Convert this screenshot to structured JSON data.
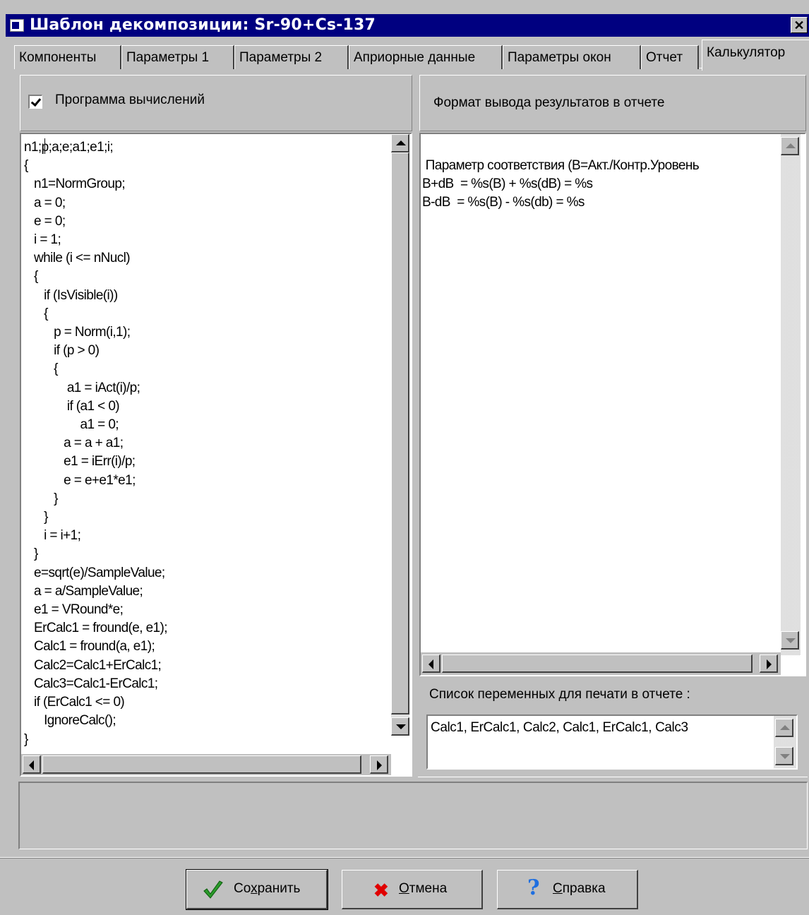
{
  "window": {
    "title": "Шаблон декомпозиции: Sr-90+Cs-137",
    "close_label": "✕"
  },
  "tabs": [
    {
      "label": "Компоненты"
    },
    {
      "label": "Параметры 1"
    },
    {
      "label": "Параметры 2"
    },
    {
      "label": "Априорные данные"
    },
    {
      "label": "Параметры окон"
    },
    {
      "label": "Отчет"
    },
    {
      "label": "Калькулятор",
      "active": true
    }
  ],
  "left_panel": {
    "checkbox_label": "Программа вычислений",
    "checked": true,
    "code": "n1;p;a;e;a1;e1;i;\n{\n   n1=NormGroup;\n   a = 0;\n   e = 0;\n   i = 1;\n   while (i <= nNucl)\n   {\n      if (IsVisible(i))\n      {\n         p = Norm(i,1);\n         if (p > 0)\n         {\n             a1 = iAct(i)/p;\n             if (a1 < 0)\n                 a1 = 0;\n            a = a + a1;\n            e1 = iErr(i)/p;\n            e = e+e1*e1;\n         }\n      }\n      i = i+1;\n   }\n   e=sqrt(e)/SampleValue;\n   a = a/SampleValue;\n   e1 = VRound*e;\n   ErCalc1 = fround(e, e1);\n   Calc1 = fround(a, e1);\n   Calc2=Calc1+ErCalc1;\n   Calc3=Calc1-ErCalc1;\n   if (ErCalc1 <= 0)\n      IgnoreCalc();\n}"
  },
  "right_panel": {
    "format_header": "Формат вывода результатов в отчете",
    "format_text": " Параметр соответствия (B=Акт./Контр.Уровень\nB+dB  = %s(B) + %s(dB) = %s\nB-dB  = %s(B) - %s(db) = %s",
    "variables_label": "Список переменных для печати в отчете :",
    "variables_value": "Calc1, ErCalc1, Calc2, Calc1, ErCalc1, Calc3"
  },
  "buttons": {
    "save": {
      "pre": "Со",
      "accel": "х",
      "post": "ранить"
    },
    "cancel": {
      "pre": "",
      "accel": "О",
      "post": "тмена"
    },
    "help": {
      "pre": "",
      "accel": "С",
      "post": "правка"
    }
  },
  "icons": {
    "title": "app-window-icon",
    "save": "green-checkmark-icon",
    "cancel": "red-x-icon",
    "help": "blue-question-icon"
  },
  "colors": {
    "titlebar": "#000080",
    "face": "#c0c0c0",
    "check_green": "#2a9a2a",
    "cancel_red": "#e00000",
    "help_blue": "#1f6fe0"
  }
}
